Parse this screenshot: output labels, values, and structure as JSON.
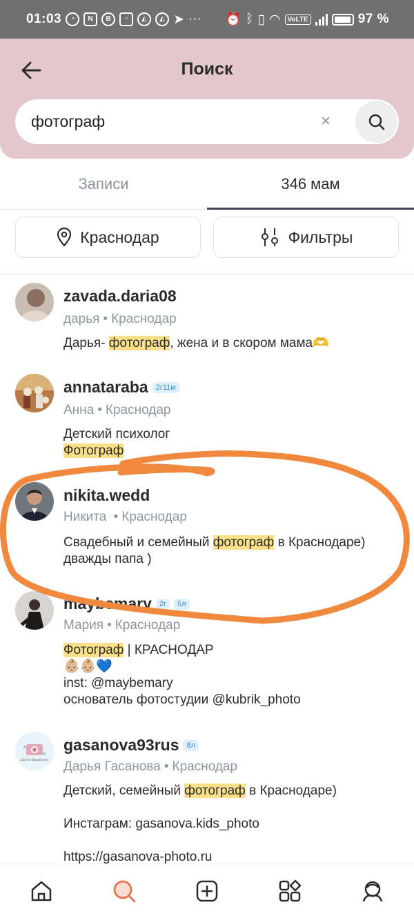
{
  "status_bar": {
    "time": "01:03",
    "left_icons": [
      "speed-icon",
      "n-icon",
      "b-icon",
      "nfc-icon",
      "app-icon",
      "app-icon",
      "telegram-icon",
      "more-icon"
    ],
    "volte": "VoLTE",
    "battery": "97 %"
  },
  "header": {
    "title": "Поиск",
    "search_value": "фотограф",
    "clear_label": "×"
  },
  "tabs": [
    {
      "label": "Записи",
      "active": false
    },
    {
      "label": "346 мам",
      "active": true
    }
  ],
  "filters": {
    "city_label": "Краснодар",
    "filters_label": "Фильтры"
  },
  "results": [
    {
      "username": "zavada.daria08",
      "badges": [],
      "name": "дарья",
      "city": "Краснодар",
      "bio": [
        [
          {
            "t": "Дарья- "
          },
          {
            "t": "фотограф",
            "hl": true
          },
          {
            "t": ", жена и в скором мама🫶"
          }
        ]
      ]
    },
    {
      "username": "annataraba",
      "badges": [
        "2г11м"
      ],
      "name": "Анна",
      "city": "Краснодар",
      "bio": [
        [
          {
            "t": "Детский психолог"
          }
        ],
        [
          {
            "t": "Фотограф",
            "hl": true
          }
        ]
      ]
    },
    {
      "username": "nikita.wedd",
      "badges": [],
      "name": "Никита ",
      "city": "Краснодар",
      "bio": [
        [
          {
            "t": "Свадебный и семейный "
          },
          {
            "t": "фотограф",
            "hl": true
          },
          {
            "t": " в Краснодаре)"
          }
        ],
        [
          {
            "t": "дважды папа )"
          }
        ]
      ]
    },
    {
      "username": "maybemary",
      "badges": [
        "2г",
        "5л"
      ],
      "name": "Мария",
      "city": "Краснодар",
      "bio": [
        [
          {
            "t": "Фотограф",
            "hl": true
          },
          {
            "t": " | КРАСНОДАР"
          }
        ],
        [
          {
            "t": "👶🏼👶🏼💙"
          }
        ],
        [
          {
            "t": "inst: @maybemary"
          }
        ],
        [
          {
            "t": "основатель фотостудии @kubrik_photo"
          }
        ]
      ]
    },
    {
      "username": "gasanova93rus",
      "badges": [
        "8л"
      ],
      "name": "Дарья Гасанова",
      "city": "Краснодар",
      "avatar_caption": "Daria Gasanova",
      "bio": [
        [
          {
            "t": "Детский, семейный "
          },
          {
            "t": "фотограф",
            "hl": true
          },
          {
            "t": " в Краснодаре)"
          }
        ],
        [
          {
            "t": ""
          }
        ],
        [
          {
            "t": "Инстаграм: gasanova.kids_photo"
          }
        ],
        [
          {
            "t": ""
          }
        ],
        [
          {
            "t": "https://gasanova-photo.ru"
          }
        ]
      ]
    }
  ],
  "bottom_nav": [
    "home-icon",
    "search-icon",
    "add-post-icon",
    "apps-icon",
    "profile-icon"
  ],
  "colors": {
    "header_bg": "#e3c7cd",
    "highlight": "#fbe08a",
    "annotation": "#f0893e",
    "search_active": "#e8734a"
  }
}
